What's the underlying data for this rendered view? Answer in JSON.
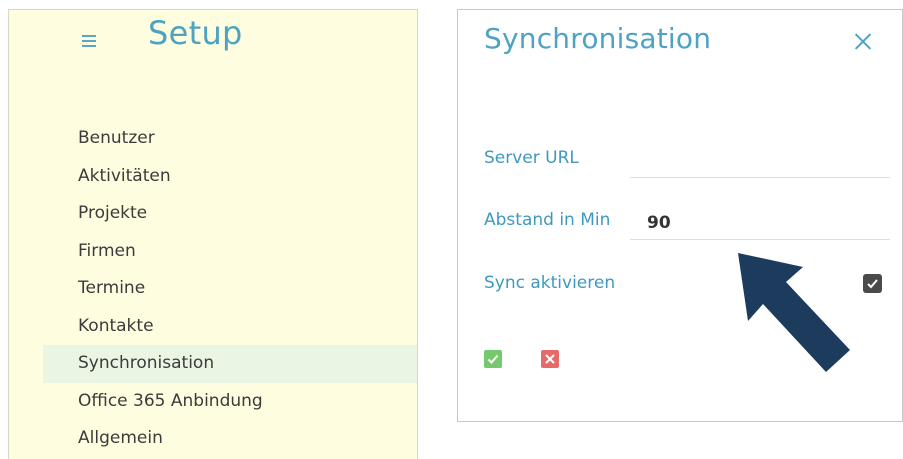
{
  "setup": {
    "title": "Setup",
    "menu_icon": "hamburger-menu-icon",
    "items": [
      {
        "label": "Benutzer"
      },
      {
        "label": "Aktivitäten"
      },
      {
        "label": "Projekte"
      },
      {
        "label": "Firmen"
      },
      {
        "label": "Termine"
      },
      {
        "label": "Kontakte"
      },
      {
        "label": "Synchronisation",
        "active": true
      },
      {
        "label": "Office 365 Anbindung"
      },
      {
        "label": "Allgemein"
      }
    ]
  },
  "dialog": {
    "title": "Synchronisation",
    "close_icon": "close-icon",
    "server_url": {
      "label": "Server URL",
      "value": ""
    },
    "interval": {
      "label": "Abstand in Min",
      "value": "90"
    },
    "sync": {
      "label": "Sync aktivieren",
      "checked": true
    },
    "confirm_icon": "check-icon",
    "cancel_icon": "x-icon"
  },
  "annotation": {
    "arrow_icon": "pointer-arrow-icon",
    "color": "#1d3b5c"
  },
  "colors": {
    "accent": "#4ea3c3",
    "panel_bg": "#fffde0",
    "active_item_bg": "#eaf5e3",
    "confirm": "#73c96b",
    "cancel": "#e56b6b"
  }
}
